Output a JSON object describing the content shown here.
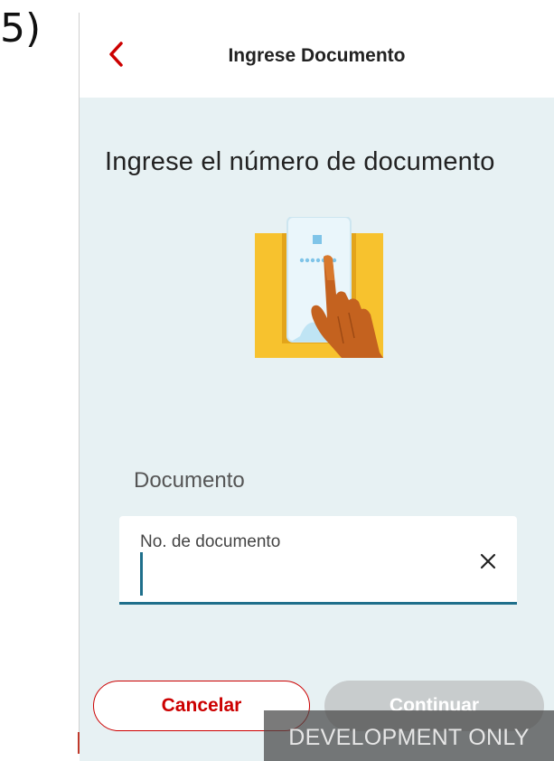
{
  "step_label": "5)",
  "header": {
    "back_icon": "chevron-left-icon",
    "title": "Ingrese Documento"
  },
  "main": {
    "title": "Ingrese el número de documento",
    "illustration_icon": "document-touch-illustration",
    "field_label": "Documento",
    "input": {
      "placeholder": "No. de documento",
      "value": "",
      "clear_icon": "close-icon"
    }
  },
  "buttons": {
    "cancel": "Cancelar",
    "continue": "Continuar"
  },
  "dev_banner": "DEVELOPMENT ONLY",
  "colors": {
    "accent_red": "#cc0000",
    "content_bg": "#e7f1f3",
    "input_underline": "#1f6f8b",
    "disabled_button": "#c8cccd",
    "illustration_yellow": "#f7c22e"
  }
}
